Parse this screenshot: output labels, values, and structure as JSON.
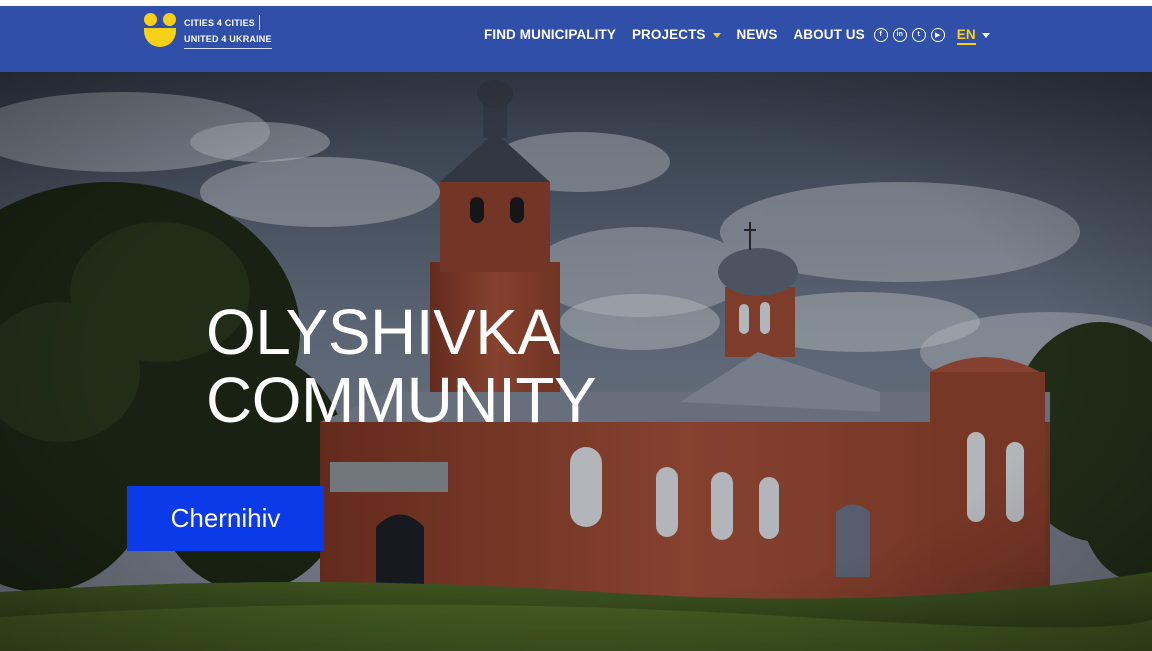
{
  "header": {
    "logo": {
      "line1": "CITIES 4 CITIES",
      "line2": "UNITED 4 UKRAINE"
    },
    "nav": [
      {
        "label": "FIND MUNICIPALITY"
      },
      {
        "label": "PROJECTS"
      },
      {
        "label": "NEWS"
      },
      {
        "label": "ABOUT US"
      }
    ],
    "social_icons": [
      "facebook-icon",
      "linkedin-icon",
      "twitter-icon",
      "youtube-icon"
    ],
    "language": "EN"
  },
  "hero": {
    "title": "OLYSHIVKA\nCOMMUNITY",
    "badge": "Chernihiv"
  },
  "colors": {
    "header_bg": "#2f4fa8",
    "accent_yellow": "#f7d117",
    "badge_bg": "#0b3ae8"
  }
}
